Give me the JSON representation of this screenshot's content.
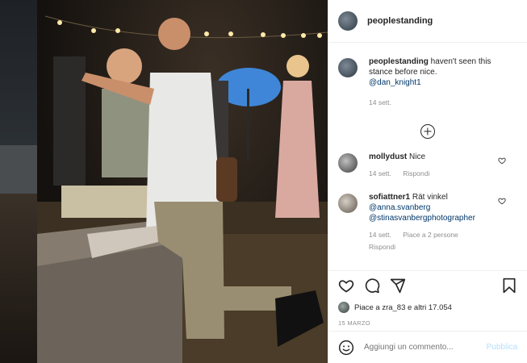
{
  "post": {
    "author": "peoplestanding"
  },
  "caption": {
    "author": "peoplestanding",
    "text": " haven't seen this stance before nice.",
    "mention": "@dan_knight1",
    "time": "14 sett."
  },
  "comments": [
    {
      "author": "mollydust",
      "text": " Nice",
      "time": "14 sett.",
      "reply": "Rispondi"
    },
    {
      "author": "sofiattner1",
      "text": " Rät vinkel",
      "mentions": [
        "@anna.svanberg",
        "@stinasvanbergphotographer"
      ],
      "time": "14 sett.",
      "likes": "Piace a 2 persone",
      "reply": "Rispondi"
    }
  ],
  "likes_summary": "Piace a zra_83 e altri 17.054",
  "date": "15 MARZO",
  "comment_box": {
    "placeholder": "Aggiungi un commento...",
    "post_label": "Pubblica"
  },
  "icons": {
    "like": "heart-icon",
    "comment": "comment-icon",
    "share": "share-icon",
    "save": "bookmark-icon",
    "more": "plus-circle-icon",
    "emoji": "emoji-icon"
  },
  "colors": {
    "text": "#262626",
    "muted": "#8e8e8e",
    "mention": "#00376b",
    "post_disabled": "#b2dffc"
  }
}
